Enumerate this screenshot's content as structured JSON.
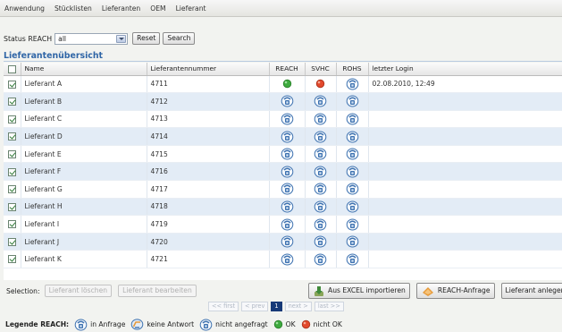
{
  "menu": [
    "Anwendung",
    "Stücklisten",
    "Lieferanten",
    "OEM",
    "Lieferant"
  ],
  "filter": {
    "label": "Status REACH",
    "value": "all",
    "reset_label": "Reset",
    "search_label": "Search"
  },
  "panel_title": "Lieferantenübersicht",
  "columns": {
    "name": "Name",
    "number": "Lieferantennummer",
    "reach": "REACH",
    "svhc": "SVHC",
    "rohs": "ROHS",
    "login": "letzter Login"
  },
  "rows": [
    {
      "name": "Lieferant A",
      "number": "4711",
      "reach": "ok",
      "svhc": "not-ok",
      "rohs": "in-request",
      "login": "02.08.2010, 12:49",
      "checked": true
    },
    {
      "name": "Lieferant B",
      "number": "4712",
      "reach": "in-request",
      "svhc": "in-request",
      "rohs": "in-request",
      "login": "",
      "checked": true
    },
    {
      "name": "Lieferant C",
      "number": "4713",
      "reach": "in-request",
      "svhc": "in-request",
      "rohs": "in-request",
      "login": "",
      "checked": true
    },
    {
      "name": "Lieferant D",
      "number": "4714",
      "reach": "in-request",
      "svhc": "in-request",
      "rohs": "in-request",
      "login": "",
      "checked": true
    },
    {
      "name": "Lieferant E",
      "number": "4715",
      "reach": "in-request",
      "svhc": "in-request",
      "rohs": "in-request",
      "login": "",
      "checked": true
    },
    {
      "name": "Lieferant F",
      "number": "4716",
      "reach": "in-request",
      "svhc": "in-request",
      "rohs": "in-request",
      "login": "",
      "checked": true
    },
    {
      "name": "Lieferant G",
      "number": "4717",
      "reach": "in-request",
      "svhc": "in-request",
      "rohs": "in-request",
      "login": "",
      "checked": true
    },
    {
      "name": "Lieferant H",
      "number": "4718",
      "reach": "in-request",
      "svhc": "in-request",
      "rohs": "in-request",
      "login": "",
      "checked": true
    },
    {
      "name": "Lieferant I",
      "number": "4719",
      "reach": "in-request",
      "svhc": "in-request",
      "rohs": "in-request",
      "login": "",
      "checked": true
    },
    {
      "name": "Lieferant J",
      "number": "4720",
      "reach": "in-request",
      "svhc": "in-request",
      "rohs": "in-request",
      "login": "",
      "checked": true
    },
    {
      "name": "Lieferant K",
      "number": "4721",
      "reach": "in-request",
      "svhc": "in-request",
      "rohs": "in-request",
      "login": "",
      "checked": true
    }
  ],
  "selection": {
    "label": "Selection:",
    "delete_label": "Lieferant löschen",
    "edit_label": "Lieferant bearbeiten"
  },
  "pager": {
    "first": "<< first",
    "prev": "< prev",
    "current": "1",
    "next": "next >",
    "last": "last >>"
  },
  "actions": {
    "excel_label": "Aus EXCEL importieren",
    "reach_label": "REACH-Anfrage",
    "create_label": "Lieferant anlegen"
  },
  "legend": {
    "title": "Legende REACH:",
    "in_request": "in Anfrage",
    "no_answer": "keine Antwort",
    "not_requested": "nicht angefragt",
    "ok": "OK",
    "not_ok": "nicht OK"
  },
  "colors": {
    "title_blue": "#2f65a6",
    "row_alt": "#e3ecf6",
    "ok_green": "#3eaa3e",
    "not_ok_red": "#e2492c",
    "icon_blue": "#3e72b0"
  }
}
